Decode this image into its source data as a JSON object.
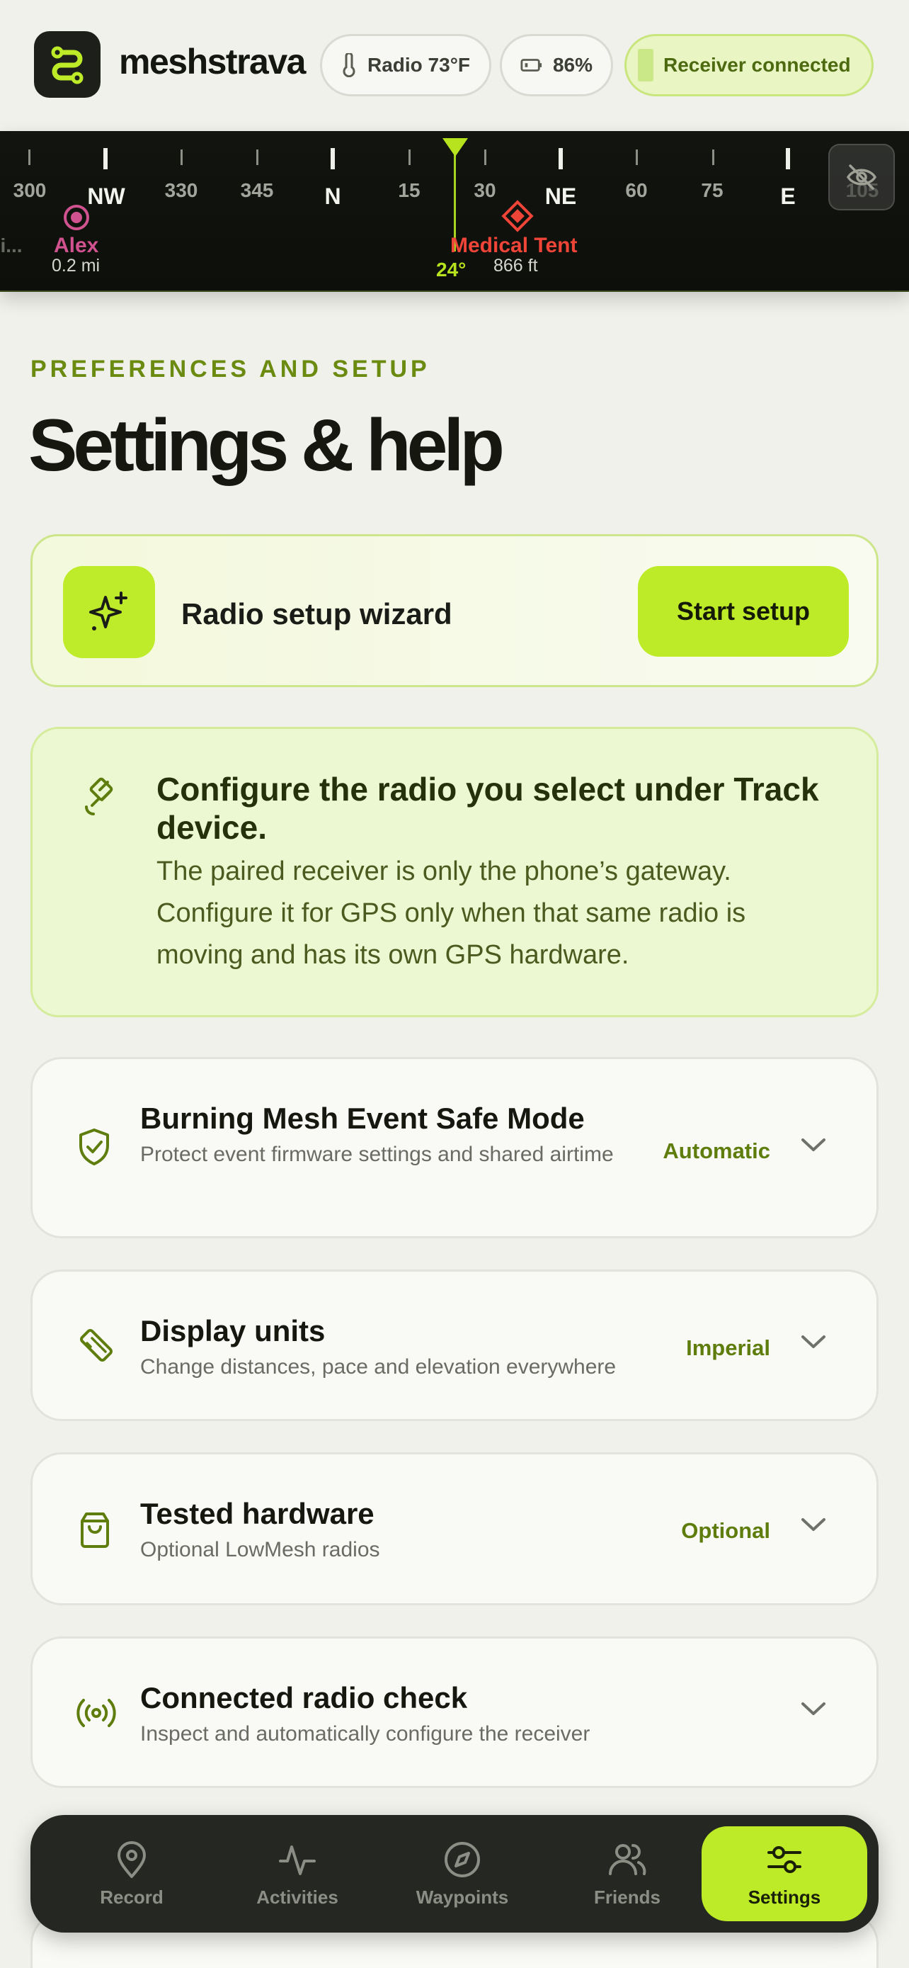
{
  "header": {
    "brand": "meshstrava",
    "radio_temp": "Radio 73°F",
    "battery": "86%",
    "receiver_status": "Receiver connected",
    "accent": "#bdeb27"
  },
  "compass": {
    "degree_labels": [
      "300",
      "330",
      "345",
      "15",
      "30",
      "60",
      "75",
      "105"
    ],
    "cardinal_labels": [
      "NW",
      "N",
      "NE",
      "E"
    ],
    "heading": "24°",
    "partial_label": "i...",
    "markers": [
      {
        "name": "Alex",
        "distance": "0.2 mi",
        "color": "#d0528f"
      },
      {
        "name": "Medical Tent",
        "distance": "866 ft",
        "color": "#ef4438"
      }
    ],
    "hide_icon": "eye-off-icon"
  },
  "page": {
    "eyebrow": "PREFERENCES AND SETUP",
    "title": "Settings & help"
  },
  "wizard": {
    "label": "Radio setup wizard",
    "button": "Start setup",
    "icon": "sparkles-icon"
  },
  "info": {
    "icon": "satellite-icon",
    "title": "Configure the radio you select under Track device.",
    "body": "The paired receiver is only the phone’s gateway. Configure it for GPS only when that same radio is moving and has its own GPS hardware."
  },
  "settings": [
    {
      "title": "Burning Mesh Event Safe Mode",
      "subtitle": "Protect event firmware settings and shared airtime",
      "value": "Automatic",
      "icon": "shield-check-icon"
    },
    {
      "title": "Display units",
      "subtitle": "Change distances, pace and elevation everywhere",
      "value": "Imperial",
      "icon": "ruler-icon"
    },
    {
      "title": "Tested hardware",
      "subtitle": "Optional LowMesh radios",
      "value": "Optional",
      "icon": "shopping-bag-icon"
    },
    {
      "title": "Connected radio check",
      "subtitle": "Inspect and automatically configure the receiver",
      "value": "",
      "icon": "radio-waves-icon"
    }
  ],
  "nav": [
    {
      "label": "Record",
      "icon": "map-pin-icon",
      "active": false
    },
    {
      "label": "Activities",
      "icon": "activity-icon",
      "active": false
    },
    {
      "label": "Waypoints",
      "icon": "compass-icon",
      "active": false
    },
    {
      "label": "Friends",
      "icon": "users-icon",
      "active": false
    },
    {
      "label": "Settings",
      "icon": "sliders-icon",
      "active": true
    }
  ]
}
